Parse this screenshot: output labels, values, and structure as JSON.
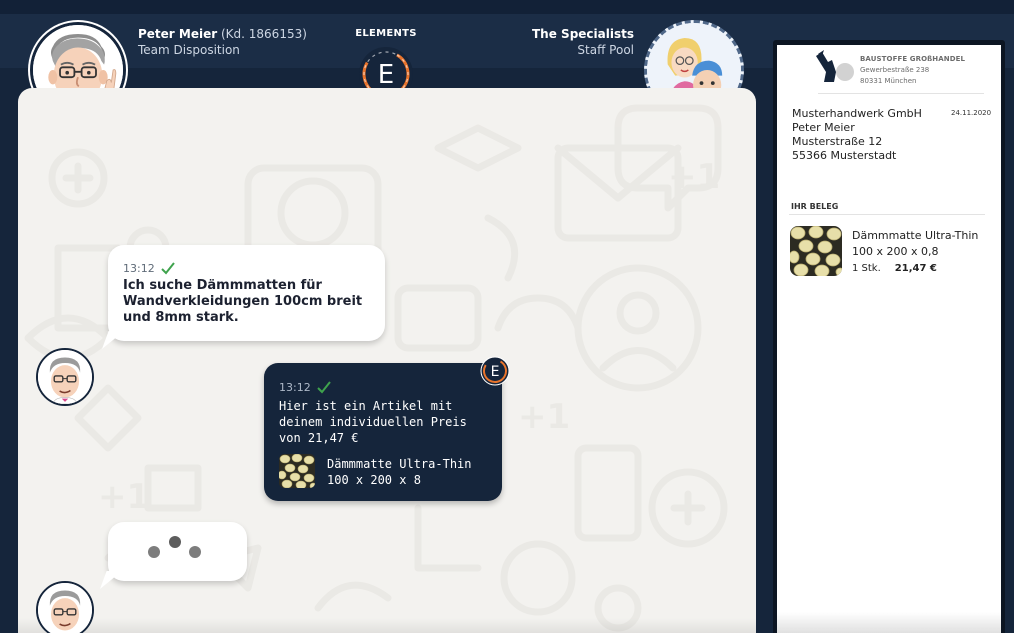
{
  "header": {
    "agent": {
      "name": "Peter Meier",
      "id": "(Kd. 1866153)",
      "role": "Team Disposition"
    },
    "brand": {
      "label": "ELEMENTS",
      "logo_letter": "E"
    },
    "team": {
      "name": "The Specialists",
      "sub": "Staff Pool"
    }
  },
  "chat": {
    "messages": [
      {
        "sender": "customer",
        "time": "13:12",
        "status": "read",
        "text": "Ich suche Dämmmatten für Wandverkleidungen 100cm breit und 8mm stark."
      },
      {
        "sender": "agent",
        "time": "13:12",
        "status": "read",
        "text": "Hier ist ein Artikel mit deinem individuellen Preis von 21,47 €",
        "product": {
          "name": "Dämmmatte Ultra-Thin",
          "size": "100 x 200 x 8"
        }
      }
    ],
    "typing_indicator": "typing-dots"
  },
  "receipt": {
    "shop": {
      "name": "BAUSTOFFE GROßHANDEL",
      "street": "Gewerbestraße 238",
      "city": "80331 München"
    },
    "date": "24.11.2020",
    "customer": {
      "company": "Musterhandwerk GmbH",
      "person": "Peter Meier",
      "street": "Musterstraße 12",
      "city": "55366 Musterstadt"
    },
    "section_label": "IHR BELEG",
    "items": [
      {
        "name": "Dämmmatte Ultra-Thin",
        "size": "100 x 200 x 0,8",
        "qty": "1 Stk.",
        "price": "21,47 €"
      }
    ]
  },
  "colors": {
    "navy": "#15253b",
    "accent": "#e8742c",
    "chat_bg": "#f3f2ef",
    "check": "#3fa34d"
  }
}
